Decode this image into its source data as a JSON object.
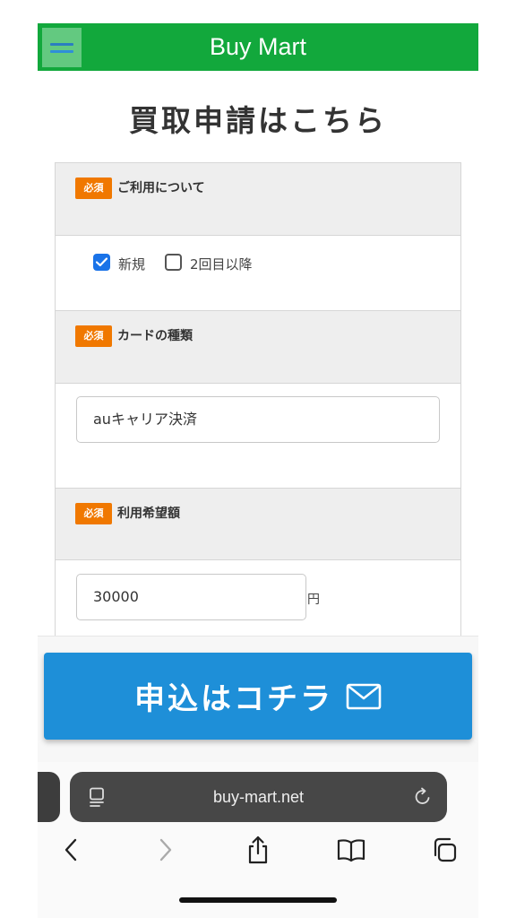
{
  "header": {
    "brand": "Buy Mart"
  },
  "page": {
    "title": "買取申請はこちら"
  },
  "form": {
    "required_badge": "必須",
    "usage": {
      "label": "ご利用について",
      "options": [
        {
          "label": "新規",
          "checked": true
        },
        {
          "label": "2回目以降",
          "checked": false
        }
      ]
    },
    "card_type": {
      "label": "カードの種類",
      "value": "auキャリア決済"
    },
    "amount": {
      "label": "利用希望額",
      "value": "30000",
      "unit": "円"
    }
  },
  "cta": {
    "label": "申込はコチラ",
    "icon": "mail-icon"
  },
  "browser": {
    "url": "buy-mart.net"
  },
  "colors": {
    "header_green": "#12a83c",
    "badge_orange": "#f07800",
    "cta_blue": "#1e8fd8"
  }
}
